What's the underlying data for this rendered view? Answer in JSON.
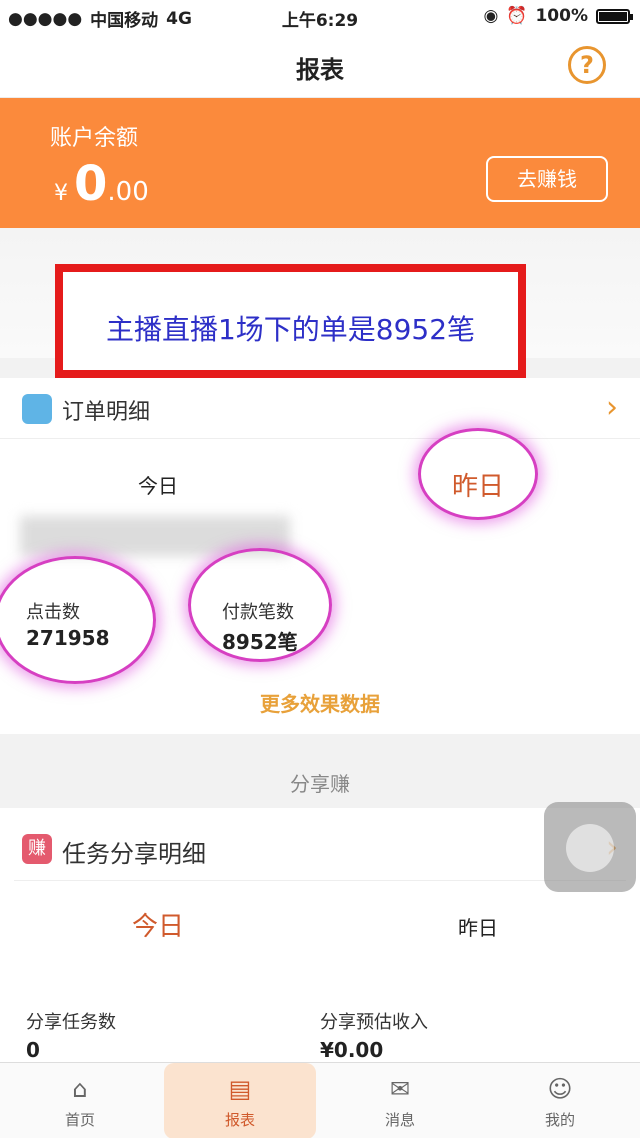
{
  "status_bar": {
    "signal": "●●●●●",
    "carrier": "中国移动",
    "network": "4G",
    "time": "上午6:29",
    "battery": "100%"
  },
  "nav": {
    "title": "报表",
    "help_icon": "?"
  },
  "balance": {
    "label": "账户余额",
    "currency": "¥",
    "amount_int": "0",
    "amount_dec": ".00",
    "earn_button": "去赚钱"
  },
  "annotation": {
    "text": "主播直播1场下的单是8952笔"
  },
  "order_detail": {
    "title": "订单明细",
    "tabs": [
      "今日",
      "昨日"
    ],
    "active_tab": 1,
    "stats": [
      {
        "label": "点击数",
        "value": "271958"
      },
      {
        "label": "付款笔数",
        "value": "8952笔"
      }
    ],
    "more_link": "更多效果数据"
  },
  "share_section": {
    "divider": "分享赚",
    "title": "任务分享明细",
    "icon_char": "赚",
    "tabs": [
      "今日",
      "昨日"
    ],
    "active_tab": 0,
    "stats": [
      {
        "label": "分享任务数",
        "value": "0"
      },
      {
        "label": "分享预估收入",
        "value": "¥0.00"
      }
    ]
  },
  "tabbar": {
    "items": [
      {
        "label": "首页",
        "icon": "home-icon"
      },
      {
        "label": "报表",
        "icon": "report-icon"
      },
      {
        "label": "消息",
        "icon": "message-icon"
      },
      {
        "label": "我的",
        "icon": "profile-icon"
      }
    ],
    "active_index": 1
  },
  "colors": {
    "accent_orange": "#fb8a3c",
    "annotation_red": "#e51b1b",
    "annotation_text": "#2d2fc7",
    "highlight_circle": "#d63fc2",
    "active_tab": "#d05a2c"
  }
}
